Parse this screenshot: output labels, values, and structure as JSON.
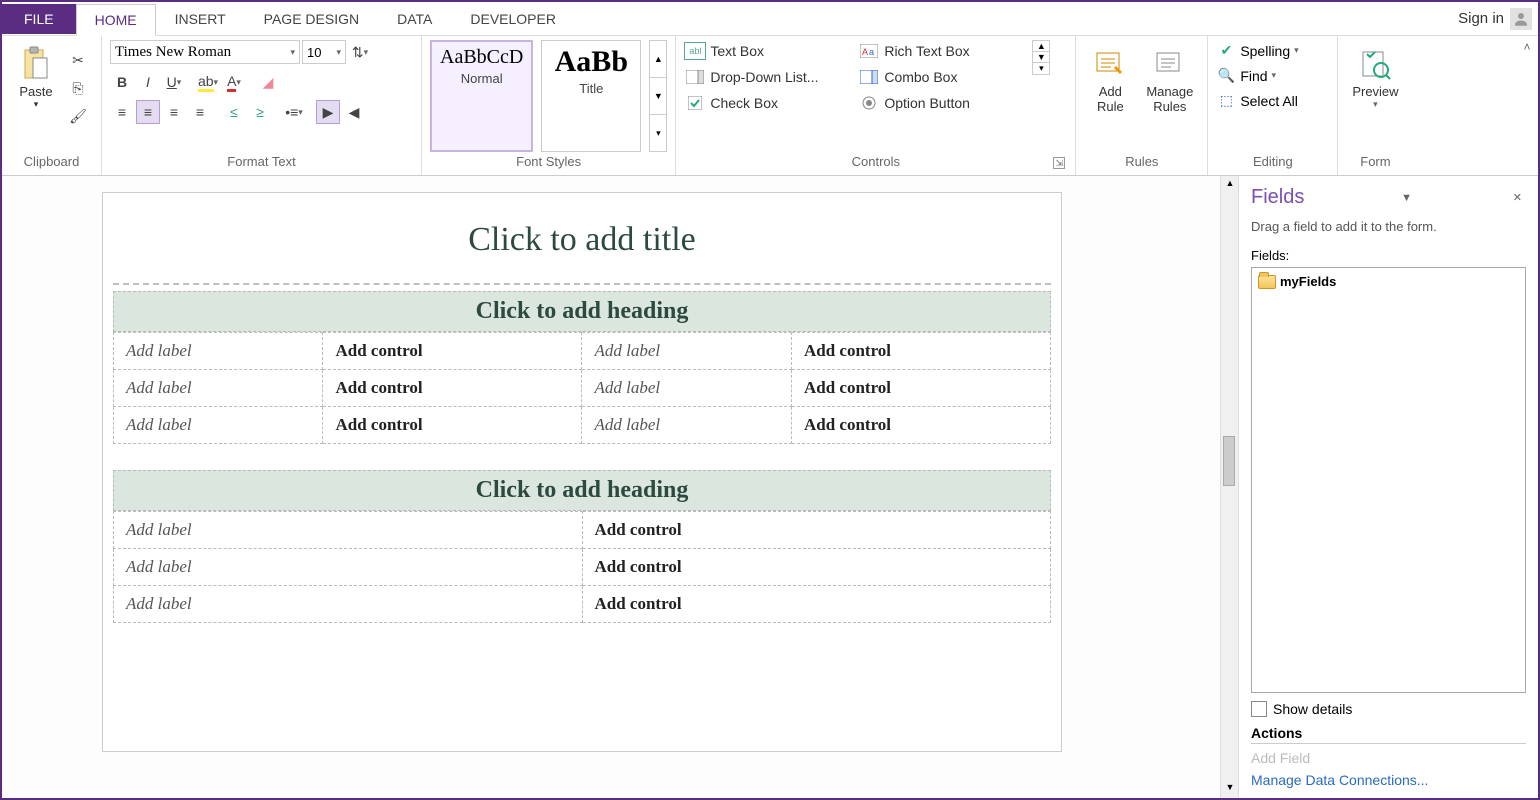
{
  "tabs": {
    "file": "FILE",
    "home": "HOME",
    "insert": "INSERT",
    "pageDesign": "PAGE DESIGN",
    "data": "DATA",
    "developer": "DEVELOPER"
  },
  "signin": "Sign in",
  "ribbon": {
    "clipboard": {
      "paste": "Paste",
      "label": "Clipboard"
    },
    "formatText": {
      "font": "Times New Roman",
      "size": "10",
      "label": "Format Text"
    },
    "fontStyles": {
      "normal_preview": "AaBbCcD",
      "normal": "Normal",
      "title_preview": "AaBb",
      "title": "Title",
      "label": "Font Styles"
    },
    "controls": {
      "textBox": "Text Box",
      "dropDown": "Drop-Down List...",
      "checkBox": "Check Box",
      "richText": "Rich Text Box",
      "combo": "Combo Box",
      "option": "Option Button",
      "label": "Controls"
    },
    "rules": {
      "addRule": "Add\nRule",
      "manageRules": "Manage\nRules",
      "label": "Rules"
    },
    "editing": {
      "spelling": "Spelling",
      "find": "Find",
      "selectAll": "Select All",
      "label": "Editing"
    },
    "form": {
      "preview": "Preview",
      "label": "Form"
    }
  },
  "canvas": {
    "title": "Click to add title",
    "heading": "Click to add heading",
    "addLabel": "Add label",
    "addControl": "Add control"
  },
  "fieldsPane": {
    "title": "Fields",
    "desc": "Drag a field to add it to the form.",
    "fieldsLabel": "Fields:",
    "root": "myFields",
    "showDetails": "Show details",
    "actions": "Actions",
    "addField": "Add Field",
    "manageConn": "Manage Data Connections..."
  }
}
